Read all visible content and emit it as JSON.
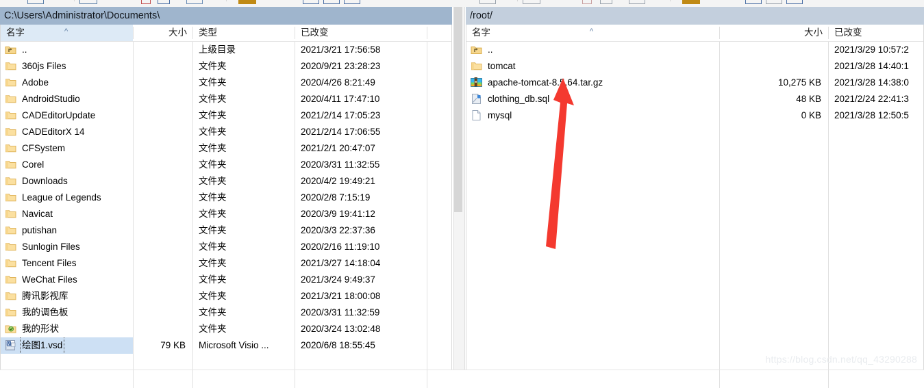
{
  "window": {
    "watermark": "https://blog.csdn.net/qq_43290288"
  },
  "left_pane": {
    "path": "C:\\Users\\Administrator\\Documents\\",
    "columns": {
      "name": "名字",
      "size": "大小",
      "type": "类型",
      "modified": "已改变"
    },
    "sort_indicator": "^",
    "rows": [
      {
        "icon": "up-folder-icon",
        "name": "..",
        "size": "",
        "type": "上级目录",
        "modified": "2021/3/21  17:56:58",
        "selected": false
      },
      {
        "icon": "folder-icon",
        "name": "360js Files",
        "size": "",
        "type": "文件夹",
        "modified": "2020/9/21  23:28:23",
        "selected": false
      },
      {
        "icon": "folder-icon",
        "name": "Adobe",
        "size": "",
        "type": "文件夹",
        "modified": "2020/4/26  8:21:49",
        "selected": false
      },
      {
        "icon": "folder-icon",
        "name": "AndroidStudio",
        "size": "",
        "type": "文件夹",
        "modified": "2020/4/11  17:47:10",
        "selected": false
      },
      {
        "icon": "folder-icon",
        "name": "CADEditorUpdate",
        "size": "",
        "type": "文件夹",
        "modified": "2021/2/14  17:05:23",
        "selected": false
      },
      {
        "icon": "folder-icon",
        "name": "CADEditorX 14",
        "size": "",
        "type": "文件夹",
        "modified": "2021/2/14  17:06:55",
        "selected": false
      },
      {
        "icon": "folder-icon",
        "name": "CFSystem",
        "size": "",
        "type": "文件夹",
        "modified": "2021/2/1  20:47:07",
        "selected": false
      },
      {
        "icon": "folder-icon",
        "name": "Corel",
        "size": "",
        "type": "文件夹",
        "modified": "2020/3/31  11:32:55",
        "selected": false
      },
      {
        "icon": "folder-icon",
        "name": "Downloads",
        "size": "",
        "type": "文件夹",
        "modified": "2020/4/2  19:49:21",
        "selected": false
      },
      {
        "icon": "folder-icon",
        "name": "League of Legends",
        "size": "",
        "type": "文件夹",
        "modified": "2020/2/8  7:15:19",
        "selected": false
      },
      {
        "icon": "folder-icon",
        "name": "Navicat",
        "size": "",
        "type": "文件夹",
        "modified": "2020/3/9  19:41:12",
        "selected": false
      },
      {
        "icon": "folder-icon",
        "name": "putishan",
        "size": "",
        "type": "文件夹",
        "modified": "2020/3/3  22:37:36",
        "selected": false
      },
      {
        "icon": "folder-icon",
        "name": "Sunlogin Files",
        "size": "",
        "type": "文件夹",
        "modified": "2020/2/16  11:19:10",
        "selected": false
      },
      {
        "icon": "folder-icon",
        "name": "Tencent Files",
        "size": "",
        "type": "文件夹",
        "modified": "2021/3/27  14:18:04",
        "selected": false
      },
      {
        "icon": "folder-icon",
        "name": "WeChat Files",
        "size": "",
        "type": "文件夹",
        "modified": "2021/3/24  9:49:37",
        "selected": false
      },
      {
        "icon": "folder-icon",
        "name": "腾讯影视库",
        "size": "",
        "type": "文件夹",
        "modified": "2021/3/21  18:00:08",
        "selected": false
      },
      {
        "icon": "folder-icon",
        "name": "我的调色板",
        "size": "",
        "type": "文件夹",
        "modified": "2020/3/31  11:32:59",
        "selected": false
      },
      {
        "icon": "shapes-folder-icon",
        "name": "我的形状",
        "size": "",
        "type": "文件夹",
        "modified": "2020/3/24  13:02:48",
        "selected": false
      },
      {
        "icon": "visio-file-icon",
        "name": "绘图1.vsd",
        "size": "79 KB",
        "type": "Microsoft Visio ...",
        "modified": "2020/6/8  18:55:45",
        "selected": true
      }
    ]
  },
  "right_pane": {
    "path": "/root/",
    "columns": {
      "name": "名字",
      "size": "大小",
      "modified": "已改变"
    },
    "sort_indicator": "^",
    "rows": [
      {
        "icon": "up-folder-icon",
        "name": "..",
        "size": "",
        "modified": "2021/3/29 10:57:2"
      },
      {
        "icon": "folder-icon",
        "name": "tomcat",
        "size": "",
        "modified": "2021/3/28 14:40:1"
      },
      {
        "icon": "archive-icon",
        "name": "apache-tomcat-8.5.64.tar.gz",
        "size": "10,275 KB",
        "modified": "2021/3/28 14:38:0"
      },
      {
        "icon": "sql-file-icon",
        "name": "clothing_db.sql",
        "size": "48 KB",
        "modified": "2021/2/24 22:41:3"
      },
      {
        "icon": "blank-file-icon",
        "name": "mysql",
        "size": "0 KB",
        "modified": "2021/3/28 12:50:5"
      }
    ]
  },
  "annotation": {
    "arrow": "red-up-arrow",
    "color": "#f03c3c"
  }
}
